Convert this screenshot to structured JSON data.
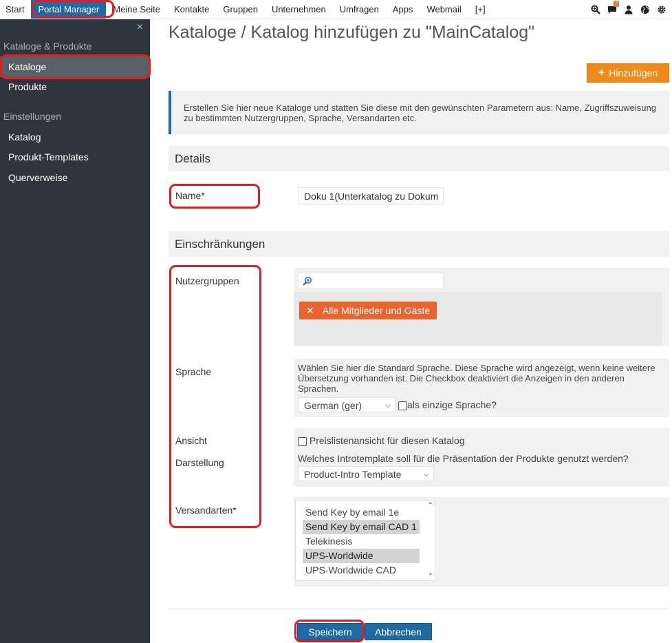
{
  "topnav": {
    "items": [
      "Start",
      "Portal Manager",
      "Meine Seite",
      "Kontakte",
      "Gruppen",
      "Unternehmen",
      "Umfragen",
      "Apps",
      "Webmail",
      "[+]"
    ],
    "active_index": 1,
    "notification_count": "2",
    "icons": [
      "search-icon",
      "chat-icon",
      "user-icon",
      "globe-icon",
      "gear-icon"
    ]
  },
  "sidebar": {
    "close": "×",
    "group1": "Kataloge & Produkte",
    "items1": [
      "Kataloge",
      "Produkte"
    ],
    "group2": "Einstellungen",
    "items2": [
      "Katalog",
      "Produkt-Templates",
      "Querverweise"
    ],
    "active_item": "Kataloge"
  },
  "page": {
    "title": "Kataloge / Katalog hinzufügen zu \"MainCatalog\"",
    "add_button": "Hinzufügen",
    "info_text": "Erstellen Sie hier neue Kataloge und statten Sie diese mit den gewünschten Parametern aus: Name, Zugriffszuweisung zu bestimmten Nutzergruppen, Sprache, Versandarten etc."
  },
  "details": {
    "heading": "Details",
    "name_label": "Name*",
    "name_value": "Doku 1(Unterkatalog zu Dokum"
  },
  "restrictions": {
    "heading": "Einschränkungen",
    "usergroups_label": "Nutzergruppen",
    "usergroup_tag": "Alle Mitglieder und Gäste",
    "language_label": "Sprache",
    "language_help": "Wählen Sie hier die Standard Sprache. Diese Sprache wird angezeigt, wenn keine weitere Übersetzung vorhanden ist. Die Checkbox deaktiviert die Anzeigen in den anderen Sprachen.",
    "language_value": "German (ger)",
    "only_language_label": "als einzige Sprache?",
    "view_label": "Ansicht",
    "pricelist_label": "Preislistenansicht für diesen Katalog",
    "display_label": "Darstellung",
    "display_help": "Welches Introtemplate soll für die Präsentation der Produkte genutzt werden?",
    "display_value": "Product-Intro Template",
    "shipping_label": "Versandarten*",
    "shipping_options": [
      {
        "label": "Send Key by email 1e",
        "selected": false
      },
      {
        "label": "Send Key by email CAD 1",
        "selected": true
      },
      {
        "label": "Telekinesis",
        "selected": false
      },
      {
        "label": "UPS-Worldwide",
        "selected": true
      },
      {
        "label": "UPS-Worldwide CAD",
        "selected": false
      }
    ]
  },
  "footer": {
    "save": "Speichern",
    "cancel": "Abbrechen"
  },
  "colors": {
    "accent": "#1f6aa3",
    "orange": "#f08a18",
    "tag": "#e8642e",
    "highlight": "#e31b23",
    "sidebar_bg": "#2f353d"
  }
}
